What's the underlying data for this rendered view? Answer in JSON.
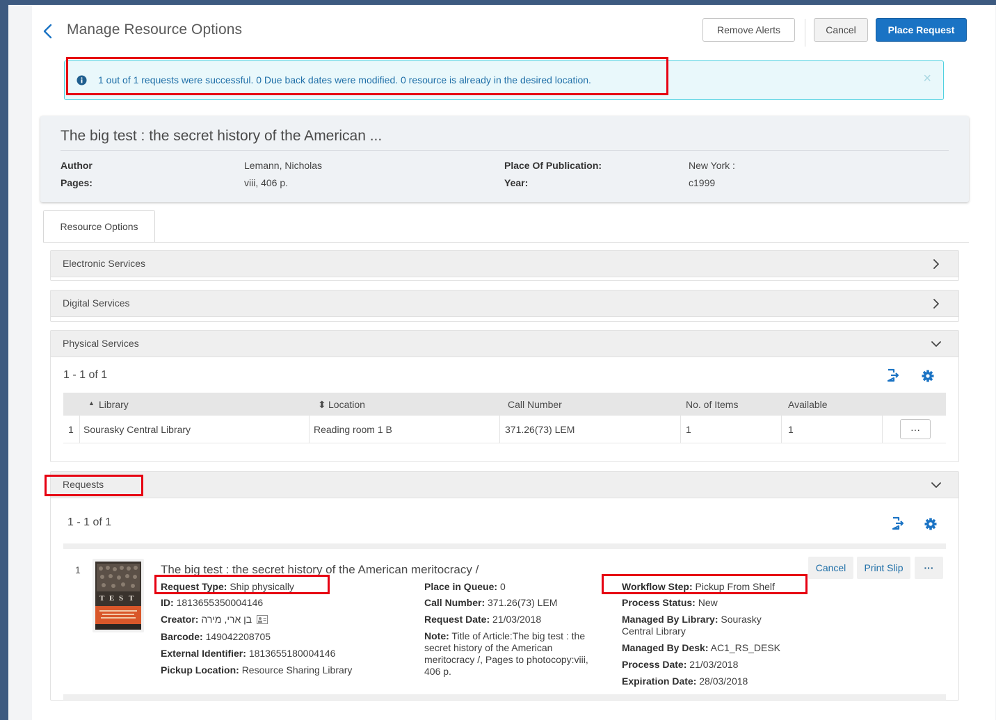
{
  "header": {
    "title": "Manage Resource Options",
    "remove_alerts_label": "Remove Alerts",
    "cancel_label": "Cancel",
    "place_request_label": "Place Request"
  },
  "alert": {
    "message": "1 out of 1 requests were successful. 0 Due back dates were modified. 0 resource is already in the desired location.",
    "close_symbol": "×"
  },
  "record": {
    "title": "The big test : the secret history of the American ...",
    "author_label": "Author",
    "author_value": "Lemann, Nicholas",
    "pages_label": "Pages:",
    "pages_value": "viii, 406 p.",
    "place_label": "Place Of Publication:",
    "place_value": "New York :",
    "year_label": "Year:",
    "year_value": "c1999"
  },
  "tabs": [
    {
      "label": "Resource Options"
    }
  ],
  "panels": {
    "electronic": {
      "title": "Electronic Services"
    },
    "digital": {
      "title": "Digital Services"
    },
    "physical": {
      "title": "Physical Services",
      "count": "1 - 1 of 1",
      "columns": [
        "Library",
        "Location",
        "Call Number",
        "No. of Items",
        "Available"
      ],
      "sort_asc_symbol": "▲",
      "sortable_symbol": "⬍",
      "rows": [
        {
          "num": "1",
          "library": "Sourasky Central Library",
          "location": "Reading room 1 B",
          "call_number": "371.26(73) LEM",
          "items": "1",
          "available": "1",
          "more": "···"
        }
      ]
    },
    "requests": {
      "title": "Requests",
      "count": "1 - 1 of 1",
      "item": {
        "num": "1",
        "title": "The big test : the secret history of the American meritocracy /",
        "cancel_label": "Cancel",
        "print_slip_label": "Print Slip",
        "more": "···",
        "col1": [
          {
            "label": "Request Type:",
            "value": "Ship physically"
          },
          {
            "label": "ID:",
            "value": "1813655350004146"
          },
          {
            "label": "Creator:",
            "value": "בן ארי, מירה"
          },
          {
            "label": "Barcode:",
            "value": "149042208705"
          },
          {
            "label": "External Identifier:",
            "value": "1813655180004146"
          },
          {
            "label": "Pickup Location:",
            "value": "Resource Sharing Library"
          }
        ],
        "col2": [
          {
            "label": "Place in Queue:",
            "value": "0"
          },
          {
            "label": "Call Number:",
            "value": "371.26(73) LEM"
          },
          {
            "label": "Request Date:",
            "value": "21/03/2018"
          },
          {
            "label": "Note:",
            "value": "Title of Article:The big test : the secret history of the American meritocracy /, Pages to photocopy:viii, 406 p."
          }
        ],
        "col3": [
          {
            "label": "Workflow Step:",
            "value": "Pickup From Shelf"
          },
          {
            "label": "Process Status:",
            "value": "New"
          },
          {
            "label": "Managed By Library:",
            "value": "Sourasky Central Library"
          },
          {
            "label": "Managed By Desk:",
            "value": "AC1_RS_DESK"
          },
          {
            "label": "Process Date:",
            "value": "21/03/2018"
          },
          {
            "label": "Expiration Date:",
            "value": "28/03/2018"
          }
        ]
      }
    }
  },
  "colors": {
    "primary": "#1a73c4",
    "alert_bg": "#e9f8fb",
    "alert_border": "#4fd1e0",
    "annotation": "#e60012",
    "frame": "#3d5a80"
  },
  "icons": {
    "back": "chevron-left-icon",
    "info": "info-circle-icon",
    "export": "export-icon",
    "settings": "gear-icon",
    "expand": "chevron-right-icon",
    "collapse": "chevron-down-icon",
    "user_card": "id-card-icon"
  }
}
